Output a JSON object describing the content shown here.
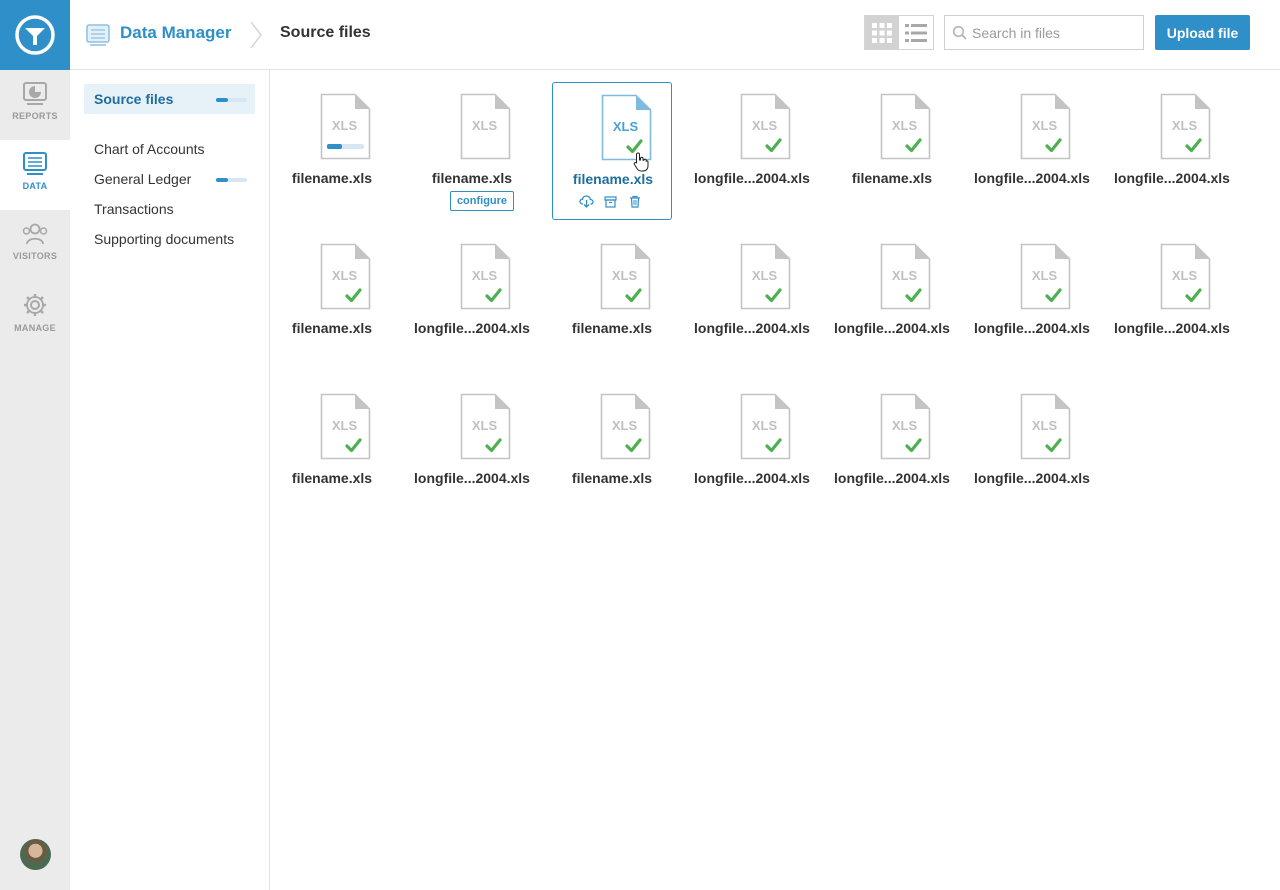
{
  "rail": {
    "items": [
      {
        "label": "REPORTS",
        "icon": "reports-icon"
      },
      {
        "label": "DATA",
        "icon": "data-icon"
      },
      {
        "label": "VISITORS",
        "icon": "visitors-icon"
      },
      {
        "label": "MANAGE",
        "icon": "manage-icon"
      }
    ],
    "active": "DATA"
  },
  "header": {
    "section": "Data Manager",
    "current": "Source files",
    "search_placeholder": "Search in files",
    "search_value": "",
    "upload_label": "Upload file",
    "view_mode": "grid"
  },
  "sidebar": {
    "items": [
      {
        "label": "Source files",
        "active": true,
        "progress": 0.4
      },
      {
        "label": "Chart of Accounts",
        "active": false
      },
      {
        "label": "General Ledger",
        "active": false,
        "progress": 0.4
      },
      {
        "label": "Transactions",
        "active": false
      },
      {
        "label": "Supporting documents",
        "active": false
      }
    ]
  },
  "files": {
    "doc_label": "XLS",
    "configure_label": "configure",
    "items": [
      {
        "name": "filename.xls",
        "state": "uploading",
        "progress": 0.4
      },
      {
        "name": "filename.xls",
        "state": "needs-config"
      },
      {
        "name": "filename.xls",
        "state": "done",
        "selected": true
      },
      {
        "name": "longfile...2004.xls",
        "state": "done"
      },
      {
        "name": "filename.xls",
        "state": "done"
      },
      {
        "name": "longfile...2004.xls",
        "state": "done"
      },
      {
        "name": "longfile...2004.xls",
        "state": "done"
      },
      {
        "name": "filename.xls",
        "state": "done"
      },
      {
        "name": "longfile...2004.xls",
        "state": "done"
      },
      {
        "name": "filename.xls",
        "state": "done"
      },
      {
        "name": "longfile...2004.xls",
        "state": "done"
      },
      {
        "name": "longfile...2004.xls",
        "state": "done"
      },
      {
        "name": "longfile...2004.xls",
        "state": "done"
      },
      {
        "name": "longfile...2004.xls",
        "state": "done"
      },
      {
        "name": "filename.xls",
        "state": "done"
      },
      {
        "name": "longfile...2004.xls",
        "state": "done"
      },
      {
        "name": "filename.xls",
        "state": "done"
      },
      {
        "name": "longfile...2004.xls",
        "state": "done"
      },
      {
        "name": "longfile...2004.xls",
        "state": "done"
      },
      {
        "name": "longfile...2004.xls",
        "state": "done"
      }
    ]
  },
  "colors": {
    "accent": "#2f8fc8",
    "check": "#4caf50",
    "doc": "#bdbdbd"
  }
}
